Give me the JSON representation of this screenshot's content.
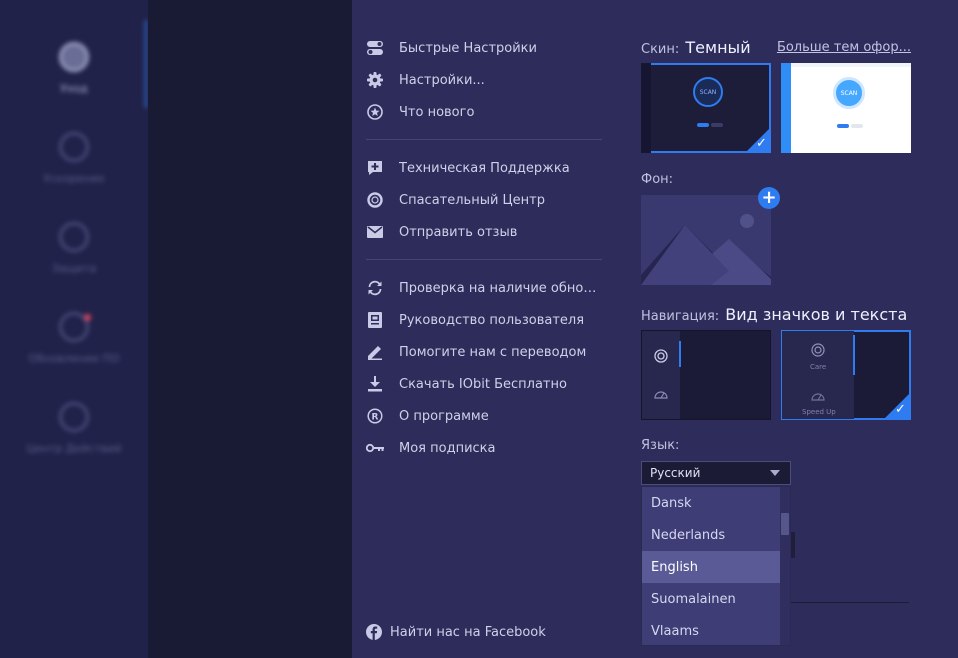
{
  "app_sidebar": {
    "items": [
      {
        "label": "Уход",
        "active": true
      },
      {
        "label": "Ускорение",
        "active": false
      },
      {
        "label": "Защита",
        "active": false
      },
      {
        "label": "Обновление ПО",
        "active": false
      },
      {
        "label": "Центр Действий",
        "active": false
      }
    ]
  },
  "menu": {
    "groups": [
      [
        {
          "icon": "toggle-icon",
          "label": "Быстрые Настройки"
        },
        {
          "icon": "gear-icon",
          "label": "Настройки..."
        },
        {
          "icon": "star-icon",
          "label": "Что нового"
        }
      ],
      [
        {
          "icon": "support-plus-icon",
          "label": "Техническая Поддержка"
        },
        {
          "icon": "lifebuoy-icon",
          "label": "Спасательный Центр"
        },
        {
          "icon": "envelope-icon",
          "label": "Отправить отзыв"
        }
      ],
      [
        {
          "icon": "refresh-icon",
          "label": "Проверка на наличие обновлений"
        },
        {
          "icon": "book-icon",
          "label": "Руководство пользователя"
        },
        {
          "icon": "pencil-icon",
          "label": "Помогите нам с переводом"
        },
        {
          "icon": "download-icon",
          "label": "Скачать IObit Бесплатно"
        },
        {
          "icon": "registered-icon",
          "label": "О программе"
        },
        {
          "icon": "key-icon",
          "label": "Моя подписка"
        }
      ]
    ],
    "facebook_label": "Найти нас на Facebook"
  },
  "skin": {
    "label": "Скин:",
    "value": "Темный",
    "more_link": "Больше тем офор...",
    "preview_button_text": "SCAN"
  },
  "background": {
    "label": "Фон:",
    "add_symbol": "+"
  },
  "navigation": {
    "label": "Навигация:",
    "value": "Вид значков и текста",
    "preview_labels": [
      "Care",
      "Speed Up"
    ]
  },
  "language": {
    "label": "Язык:",
    "selected": "Русский",
    "options": [
      "Dansk",
      "Nederlands",
      "English",
      "Suomalainen",
      "Vlaams"
    ],
    "highlighted": "English"
  },
  "colors": {
    "accent": "#2f7bf0",
    "panel": "#2d2c5b"
  }
}
